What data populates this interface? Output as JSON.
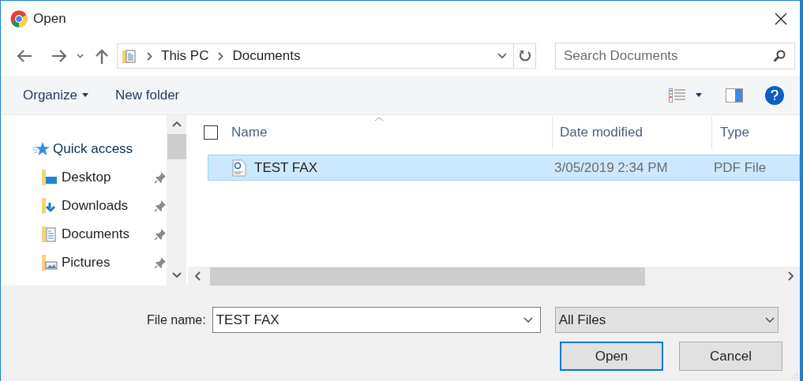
{
  "window": {
    "title": "Open"
  },
  "address": {
    "path": [
      "This PC",
      "Documents"
    ]
  },
  "search": {
    "placeholder": "Search Documents"
  },
  "toolbar": {
    "buttons": [
      "Organize",
      "New folder"
    ]
  },
  "sidebar": {
    "items": [
      {
        "label": "Quick access",
        "kind": "group",
        "pinned": false
      },
      {
        "label": "Desktop",
        "kind": "desktop",
        "pinned": true
      },
      {
        "label": "Downloads",
        "kind": "downloads",
        "pinned": true
      },
      {
        "label": "Documents",
        "kind": "documents",
        "pinned": true
      },
      {
        "label": "Pictures",
        "kind": "pictures",
        "pinned": true
      }
    ]
  },
  "table": {
    "select_all_checked": false,
    "columns": [
      "Name",
      "Date modified",
      "Type"
    ],
    "rows": [
      {
        "name": "TEST FAX",
        "date": "3/05/2019 2:34 PM",
        "type": "PDF File",
        "selected": true
      }
    ]
  },
  "footer": {
    "file_name_label": "File name:",
    "file_name": "TEST FAX",
    "file_type": "All Files",
    "buttons": [
      "Open",
      "Cancel"
    ]
  }
}
